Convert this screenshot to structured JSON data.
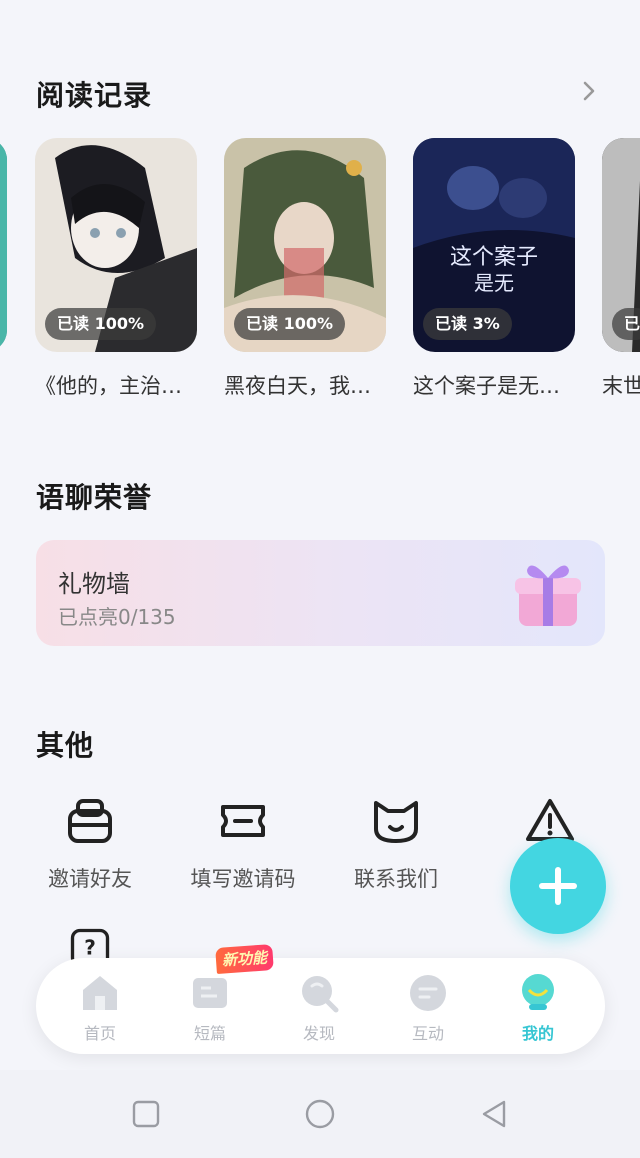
{
  "reading_records": {
    "title": "阅读记录",
    "books": [
      {
        "progress": "",
        "title": ""
      },
      {
        "progress": "已读 100%",
        "title": "《他的，主治…"
      },
      {
        "progress": "已读 100%",
        "title": "黑夜白天，我…"
      },
      {
        "progress": "已读 3%",
        "title": "这个案子是无…"
      },
      {
        "progress": "已",
        "title": "末世"
      }
    ]
  },
  "honors": {
    "title": "语聊荣誉",
    "gift_wall": {
      "title": "礼物墙",
      "subtitle": "已点亮0/135"
    }
  },
  "others": {
    "title": "其他",
    "tools": [
      {
        "label": "邀请好友",
        "icon": "invite-bag-icon"
      },
      {
        "label": "填写邀请码",
        "icon": "ticket-icon"
      },
      {
        "label": "联系我们",
        "icon": "cat-face-icon"
      },
      {
        "label": "",
        "icon": "warning-icon"
      }
    ]
  },
  "tabbar": {
    "new_badge": "新功能",
    "tabs": [
      {
        "label": "首页",
        "icon": "home-icon"
      },
      {
        "label": "短篇",
        "icon": "book-icon"
      },
      {
        "label": "发现",
        "icon": "discover-icon"
      },
      {
        "label": "互动",
        "icon": "chat-icon"
      },
      {
        "label": "我的",
        "icon": "profile-orb-icon"
      }
    ],
    "active_index": 4
  },
  "colors": {
    "accent": "#43d6e1",
    "active_tab": "#37c6d3"
  }
}
